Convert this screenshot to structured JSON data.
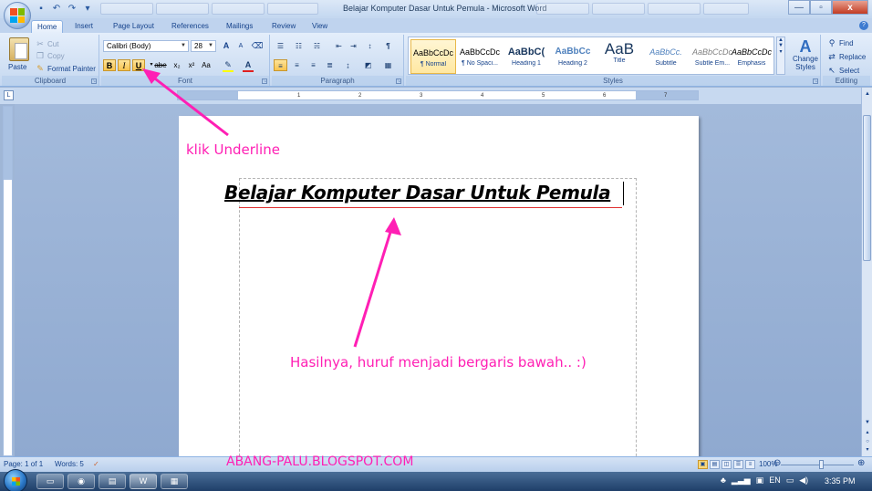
{
  "window": {
    "title": "Belajar Komputer Dasar Untuk Pemula - Microsoft Word",
    "minimize_label": "—",
    "maximize_label": "▫",
    "close_label": "x"
  },
  "qat": {
    "save_icon": "save-icon",
    "undo_icon": "undo-icon",
    "redo_icon": "redo-icon"
  },
  "ribbon_tabs": [
    "Home",
    "Insert",
    "Page Layout",
    "References",
    "Mailings",
    "Review",
    "View"
  ],
  "clipboard": {
    "label": "Clipboard",
    "paste": "Paste",
    "cut": "Cut",
    "copy": "Copy",
    "format_painter": "Format Painter"
  },
  "font": {
    "label": "Font",
    "family": "Calibri (Body)",
    "size": "28",
    "bold": "B",
    "italic": "I",
    "underline": "U",
    "strike": "abe",
    "subscript": "x₂",
    "superscript": "x²",
    "change_case": "Aa",
    "grow": "A",
    "shrink": "A"
  },
  "paragraph": {
    "label": "Paragraph"
  },
  "styles": {
    "label": "Styles",
    "items": [
      {
        "sample": "AaBbCcDc",
        "name": "¶ Normal"
      },
      {
        "sample": "AaBbCcDc",
        "name": "¶ No Spaci..."
      },
      {
        "sample": "AaBbC(",
        "name": "Heading 1"
      },
      {
        "sample": "AaBbCc",
        "name": "Heading 2"
      },
      {
        "sample": "AaB",
        "name": "Title"
      },
      {
        "sample": "AaBbCc.",
        "name": "Subtitle"
      },
      {
        "sample": "AaBbCcDc",
        "name": "Subtle Em..."
      },
      {
        "sample": "AaBbCcDc",
        "name": "Emphasis"
      }
    ],
    "change_styles": "Change Styles"
  },
  "editing": {
    "label": "Editing",
    "find": "Find",
    "replace": "Replace",
    "select": "Select"
  },
  "ruler_numbers": [
    "1",
    "2",
    "3",
    "4",
    "5",
    "6",
    "7"
  ],
  "document": {
    "heading": "Belajar Komputer Dasar Untuk Pemula"
  },
  "annotations": {
    "underline_hint": "klik Underline",
    "result_hint": "Hasilnya, huruf menjadi bergaris bawah.. :)",
    "watermark": "ABANG-PALU.BLOGSPOT.COM",
    "accent_color": "#ff1fb4"
  },
  "status": {
    "page": "Page: 1 of 1",
    "words": "Words: 5",
    "zoom": "100%"
  },
  "taskbar": {
    "time": "3:35 PM"
  }
}
